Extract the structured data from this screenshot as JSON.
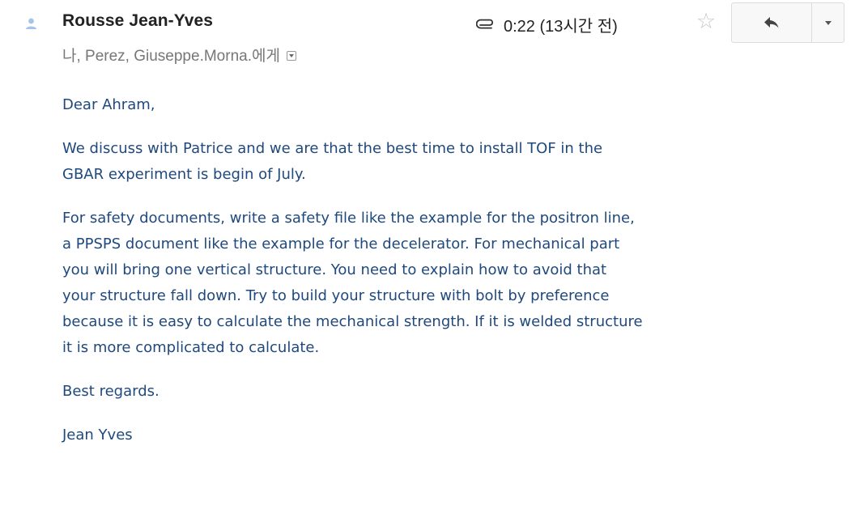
{
  "message": {
    "sender": "Rousse Jean-Yves",
    "recipients": "나, Perez, Giuseppe.Morna.에게",
    "time": "0:22 (13시간 전)",
    "has_attachment": true,
    "starred": false
  },
  "body": {
    "greeting": "Dear Ahram,",
    "para1": {
      "line1": "We discuss with Patrice and we are that the best time to install TOF in the",
      "line2": "GBAR experiment is begin of July."
    },
    "para2": {
      "line1": "For safety documents, write a safety file like the example for the positron line,",
      "line2": "a PPSPS document like the example for the decelerator. For mechanical part",
      "line3": "you will bring one vertical structure. You need to explain how to avoid that",
      "line4": "your structure fall down. Try to build your structure with bolt by preference",
      "line5": "because it is easy to calculate the mechanical strength. If it is welded structure",
      "line6": "it is more complicated to calculate."
    },
    "closing": "Best regards.",
    "signature": "Jean Yves"
  },
  "icons": {
    "avatar": "person-icon",
    "attachment": "paperclip-icon",
    "star": "star-outline-icon",
    "reply": "reply-arrow-icon",
    "more": "chevron-down-icon"
  },
  "colors": {
    "body_text": "#1f497d",
    "sender_text": "#222222",
    "meta_text": "#777777",
    "avatar": "#a6c4ea",
    "star": "#c8c8c8"
  }
}
